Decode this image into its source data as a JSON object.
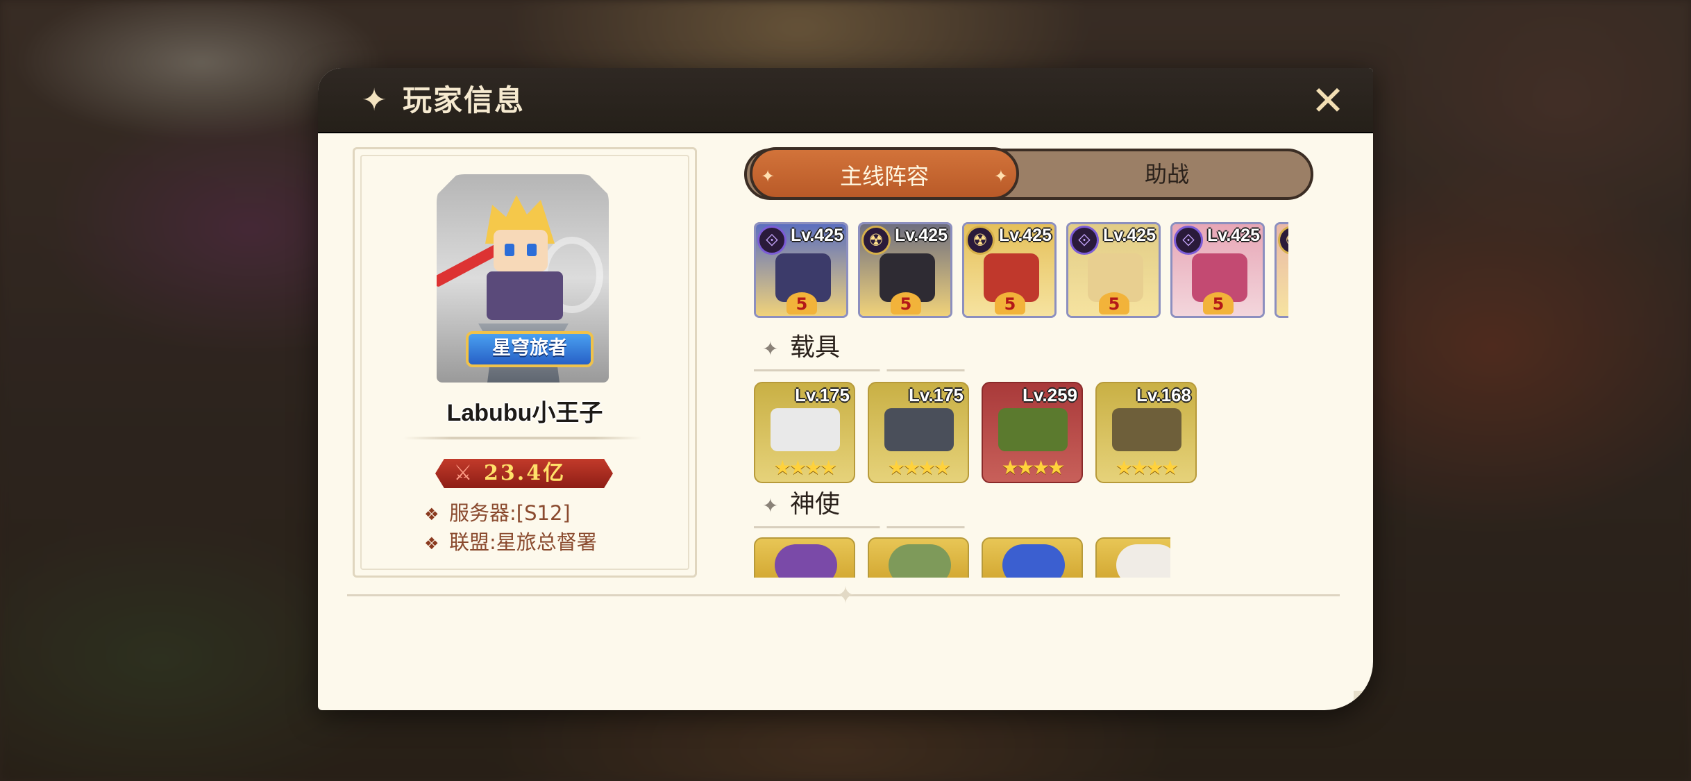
{
  "dialog": {
    "title": "玩家信息",
    "close_icon": "close-icon"
  },
  "profile": {
    "title_badge": "星穹旅者",
    "name": "Labubu小王子",
    "power": "23.4亿",
    "server": "服务器:[S12]",
    "alliance": "联盟:星旅总督署"
  },
  "tabs": [
    {
      "label": "主线阵容",
      "active": true
    },
    {
      "label": "助战",
      "active": false
    }
  ],
  "heroes": [
    {
      "level": "Lv.425",
      "rank": "5",
      "element": "arcane-icon",
      "bg": "#5c6fbf",
      "fig": "#3c3b6a"
    },
    {
      "level": "Lv.425",
      "rank": "5",
      "element": "dark-icon",
      "bg": "#6f6f80",
      "fig": "#2e2b33"
    },
    {
      "level": "Lv.425",
      "rank": "5",
      "element": "dark-icon",
      "bg": "#e5c05a",
      "fig": "#c0382c"
    },
    {
      "level": "Lv.425",
      "rank": "5",
      "element": "arcane-icon",
      "bg": "#e1cc86",
      "fig": "#e8cf90"
    },
    {
      "level": "Lv.425",
      "rank": "5",
      "element": "arcane-icon",
      "bg": "#e7a6b6",
      "fig": "#c34a72"
    },
    {
      "level": "",
      "rank": "",
      "element": "dark-icon",
      "bg": "#e9b8a8",
      "fig": "#e9b8a8"
    }
  ],
  "sections": {
    "vehicles": "载具",
    "envoys": "神使"
  },
  "vehicles": [
    {
      "level": "Lv.175",
      "stars": "★★★★",
      "bg": "#c9b045",
      "fig": "#e9e9e9"
    },
    {
      "level": "Lv.175",
      "stars": "★★★★",
      "bg": "#c9b045",
      "fig": "#4a4f5a"
    },
    {
      "level": "Lv.259",
      "stars": "★★★★",
      "bg": "#a93a3a",
      "fig": "#5b7a2e"
    },
    {
      "level": "Lv.168",
      "stars": "★★★★",
      "bg": "#c9b045",
      "fig": "#6e5f3a"
    }
  ],
  "envoys": [
    {
      "fig": "#7a4aa8"
    },
    {
      "fig": "#7e9a5a"
    },
    {
      "fig": "#3b5fd0"
    },
    {
      "fig": "#f0ece6"
    }
  ],
  "colors": {
    "header_bg": "#2a241e",
    "panel_bg": "#fdf9ec",
    "tab_active": "#c8652f",
    "tab_inactive": "#9b7f66",
    "power_bar": "#a82a1f",
    "power_text": "#ffe16a"
  }
}
